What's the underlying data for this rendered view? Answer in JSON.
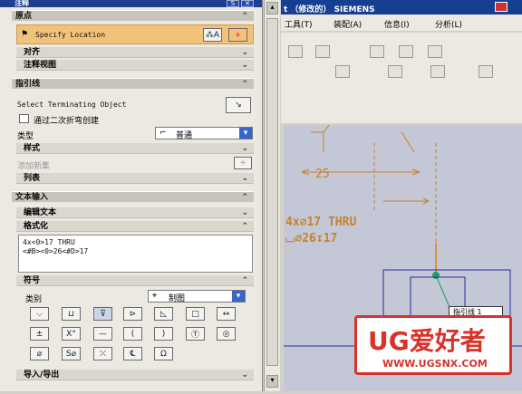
{
  "window": {
    "title": "注释"
  },
  "origin": {
    "header": "原点",
    "specify_location": "Specify Location",
    "align": "对齐",
    "annotation_view": "注释视图"
  },
  "leader": {
    "header": "指引线",
    "select_terminating": "Select Terminating Object",
    "create_with_jog": "通过二次折弯创建",
    "type_label": "类型",
    "type_value": "普通",
    "style": "样式",
    "add_new_set": "添加新集",
    "list": "列表"
  },
  "text_input": {
    "header": "文本输入",
    "edit_text": "编辑文本",
    "format": "格式化",
    "lines": [
      "4x<0>17 THRU",
      "<#B><0>26<#D>17"
    ]
  },
  "symbols": {
    "header": "符号",
    "category_label": "类别",
    "category_value": "制图",
    "row1": [
      "⌵",
      "⊔",
      "⊽",
      "⊳",
      "◺",
      "□",
      "↔"
    ],
    "row2": [
      "±",
      "X°",
      "—",
      "(",
      ")",
      "Ⓣ",
      "◎"
    ],
    "row3": [
      "⌀",
      "S⌀",
      "⤫",
      "℄",
      "Ω"
    ]
  },
  "import_export": "导入/导出",
  "app": {
    "title_frag": "t （修改的） SIEMENS",
    "menu": [
      "工具(T)",
      "装配(A)",
      "信息(I)",
      "分析(L)"
    ]
  },
  "drawing": {
    "dim_25": "25",
    "callout_line1": "4x⌀17 THRU",
    "callout_line2": "⌴⌀26↧17",
    "label_leader": "指引线 1",
    "watermark_title": "UG爱好者",
    "watermark_url": "WWW.UGSNX.COM"
  },
  "colors": {
    "title_bar": "#1c3f8f",
    "highlight": "#f3c27a",
    "dim_brown": "#c7812b",
    "watermark_red": "#d9322a"
  }
}
